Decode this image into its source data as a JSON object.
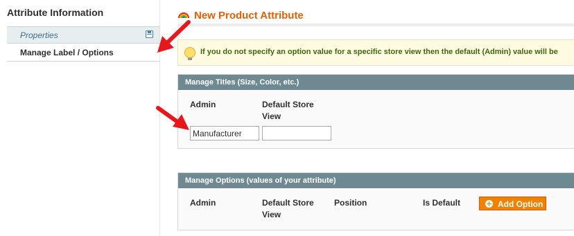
{
  "sidebar": {
    "title": "Attribute Information",
    "items": [
      {
        "label": "Properties",
        "icon": "save-icon"
      },
      {
        "label": "Manage Label / Options"
      }
    ]
  },
  "header": {
    "title": "New Product Attribute",
    "icon": "rainbow-icon"
  },
  "notice": {
    "icon": "lightbulb-icon",
    "text": "If you do not specify an option value for a specific store view then the default (Admin) value will be"
  },
  "manage_titles": {
    "heading": "Manage Titles (Size, Color, etc.)",
    "columns": [
      "Admin",
      "Default Store View"
    ],
    "admin_value": "Manufacturer",
    "default_store_value": ""
  },
  "manage_options": {
    "heading": "Manage Options (values of your attribute)",
    "columns": [
      "Admin",
      "Default Store View",
      "Position",
      "Is Default"
    ],
    "add_button_label": "Add Option"
  },
  "colors": {
    "title_orange": "#eb5e00",
    "section_header": "#6f8992",
    "button_orange": "#f18200",
    "annotation_arrow": "#e8171b"
  }
}
